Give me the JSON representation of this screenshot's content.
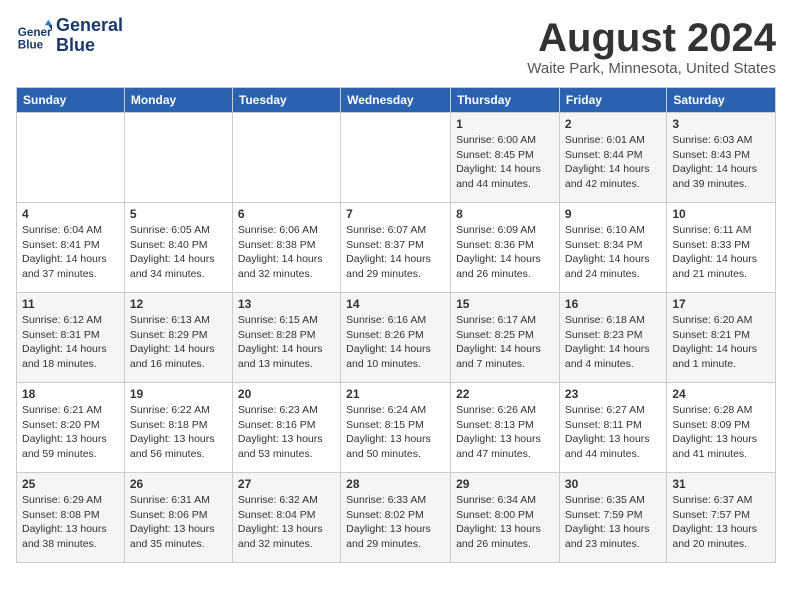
{
  "header": {
    "logo_line1": "General",
    "logo_line2": "Blue",
    "month": "August 2024",
    "location": "Waite Park, Minnesota, United States"
  },
  "days_of_week": [
    "Sunday",
    "Monday",
    "Tuesday",
    "Wednesday",
    "Thursday",
    "Friday",
    "Saturday"
  ],
  "weeks": [
    [
      {
        "day": "",
        "info": ""
      },
      {
        "day": "",
        "info": ""
      },
      {
        "day": "",
        "info": ""
      },
      {
        "day": "",
        "info": ""
      },
      {
        "day": "1",
        "info": "Sunrise: 6:00 AM\nSunset: 8:45 PM\nDaylight: 14 hours\nand 44 minutes."
      },
      {
        "day": "2",
        "info": "Sunrise: 6:01 AM\nSunset: 8:44 PM\nDaylight: 14 hours\nand 42 minutes."
      },
      {
        "day": "3",
        "info": "Sunrise: 6:03 AM\nSunset: 8:43 PM\nDaylight: 14 hours\nand 39 minutes."
      }
    ],
    [
      {
        "day": "4",
        "info": "Sunrise: 6:04 AM\nSunset: 8:41 PM\nDaylight: 14 hours\nand 37 minutes."
      },
      {
        "day": "5",
        "info": "Sunrise: 6:05 AM\nSunset: 8:40 PM\nDaylight: 14 hours\nand 34 minutes."
      },
      {
        "day": "6",
        "info": "Sunrise: 6:06 AM\nSunset: 8:38 PM\nDaylight: 14 hours\nand 32 minutes."
      },
      {
        "day": "7",
        "info": "Sunrise: 6:07 AM\nSunset: 8:37 PM\nDaylight: 14 hours\nand 29 minutes."
      },
      {
        "day": "8",
        "info": "Sunrise: 6:09 AM\nSunset: 8:36 PM\nDaylight: 14 hours\nand 26 minutes."
      },
      {
        "day": "9",
        "info": "Sunrise: 6:10 AM\nSunset: 8:34 PM\nDaylight: 14 hours\nand 24 minutes."
      },
      {
        "day": "10",
        "info": "Sunrise: 6:11 AM\nSunset: 8:33 PM\nDaylight: 14 hours\nand 21 minutes."
      }
    ],
    [
      {
        "day": "11",
        "info": "Sunrise: 6:12 AM\nSunset: 8:31 PM\nDaylight: 14 hours\nand 18 minutes."
      },
      {
        "day": "12",
        "info": "Sunrise: 6:13 AM\nSunset: 8:29 PM\nDaylight: 14 hours\nand 16 minutes."
      },
      {
        "day": "13",
        "info": "Sunrise: 6:15 AM\nSunset: 8:28 PM\nDaylight: 14 hours\nand 13 minutes."
      },
      {
        "day": "14",
        "info": "Sunrise: 6:16 AM\nSunset: 8:26 PM\nDaylight: 14 hours\nand 10 minutes."
      },
      {
        "day": "15",
        "info": "Sunrise: 6:17 AM\nSunset: 8:25 PM\nDaylight: 14 hours\nand 7 minutes."
      },
      {
        "day": "16",
        "info": "Sunrise: 6:18 AM\nSunset: 8:23 PM\nDaylight: 14 hours\nand 4 minutes."
      },
      {
        "day": "17",
        "info": "Sunrise: 6:20 AM\nSunset: 8:21 PM\nDaylight: 14 hours\nand 1 minute."
      }
    ],
    [
      {
        "day": "18",
        "info": "Sunrise: 6:21 AM\nSunset: 8:20 PM\nDaylight: 13 hours\nand 59 minutes."
      },
      {
        "day": "19",
        "info": "Sunrise: 6:22 AM\nSunset: 8:18 PM\nDaylight: 13 hours\nand 56 minutes."
      },
      {
        "day": "20",
        "info": "Sunrise: 6:23 AM\nSunset: 8:16 PM\nDaylight: 13 hours\nand 53 minutes."
      },
      {
        "day": "21",
        "info": "Sunrise: 6:24 AM\nSunset: 8:15 PM\nDaylight: 13 hours\nand 50 minutes."
      },
      {
        "day": "22",
        "info": "Sunrise: 6:26 AM\nSunset: 8:13 PM\nDaylight: 13 hours\nand 47 minutes."
      },
      {
        "day": "23",
        "info": "Sunrise: 6:27 AM\nSunset: 8:11 PM\nDaylight: 13 hours\nand 44 minutes."
      },
      {
        "day": "24",
        "info": "Sunrise: 6:28 AM\nSunset: 8:09 PM\nDaylight: 13 hours\nand 41 minutes."
      }
    ],
    [
      {
        "day": "25",
        "info": "Sunrise: 6:29 AM\nSunset: 8:08 PM\nDaylight: 13 hours\nand 38 minutes."
      },
      {
        "day": "26",
        "info": "Sunrise: 6:31 AM\nSunset: 8:06 PM\nDaylight: 13 hours\nand 35 minutes."
      },
      {
        "day": "27",
        "info": "Sunrise: 6:32 AM\nSunset: 8:04 PM\nDaylight: 13 hours\nand 32 minutes."
      },
      {
        "day": "28",
        "info": "Sunrise: 6:33 AM\nSunset: 8:02 PM\nDaylight: 13 hours\nand 29 minutes."
      },
      {
        "day": "29",
        "info": "Sunrise: 6:34 AM\nSunset: 8:00 PM\nDaylight: 13 hours\nand 26 minutes."
      },
      {
        "day": "30",
        "info": "Sunrise: 6:35 AM\nSunset: 7:59 PM\nDaylight: 13 hours\nand 23 minutes."
      },
      {
        "day": "31",
        "info": "Sunrise: 6:37 AM\nSunset: 7:57 PM\nDaylight: 13 hours\nand 20 minutes."
      }
    ]
  ]
}
